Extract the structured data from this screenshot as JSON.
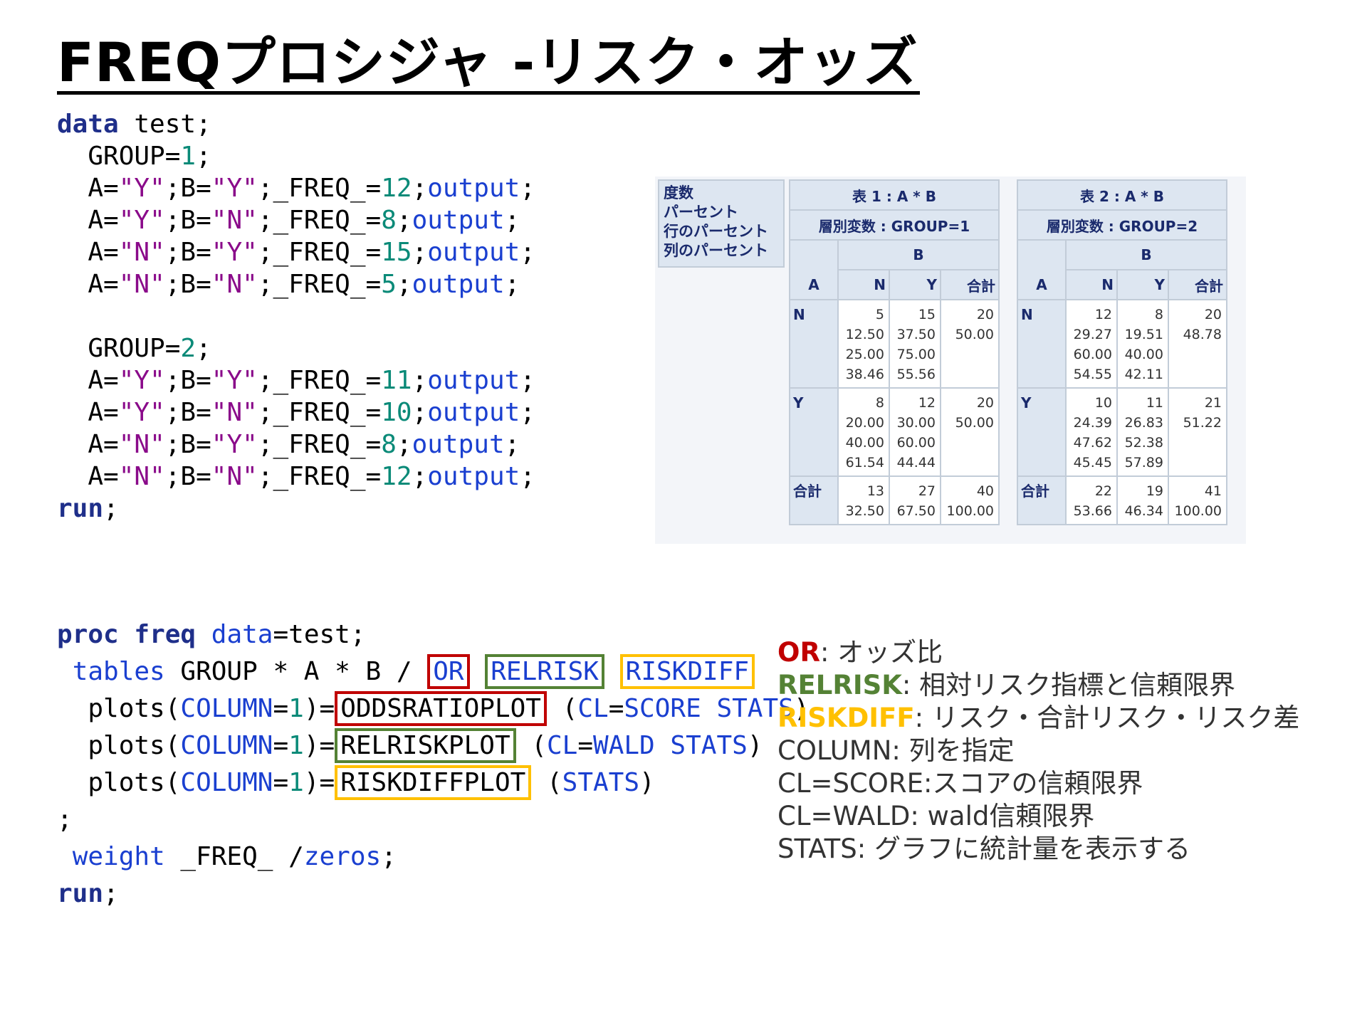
{
  "title": "FREQプロシジャ -リスク・オッズ",
  "data_step": {
    "kw_data": "data",
    "ds_name": " test;",
    "group1": "GROUP=",
    "group1_val": "1",
    "semi": ";",
    "g1_lines": [
      {
        "a": "\"Y\"",
        "b": "\"Y\"",
        "freq": "12"
      },
      {
        "a": "\"Y\"",
        "b": "\"N\"",
        "freq": "8"
      },
      {
        "a": "\"N\"",
        "b": "\"Y\"",
        "freq": "15"
      },
      {
        "a": "\"N\"",
        "b": "\"N\"",
        "freq": "5"
      }
    ],
    "group2_val": "2",
    "g2_lines": [
      {
        "a": "\"Y\"",
        "b": "\"Y\"",
        "freq": "11"
      },
      {
        "a": "\"Y\"",
        "b": "\"N\"",
        "freq": "10"
      },
      {
        "a": "\"N\"",
        "b": "\"Y\"",
        "freq": "8"
      },
      {
        "a": "\"N\"",
        "b": "\"N\"",
        "freq": "12"
      }
    ],
    "a_eq": "A=",
    "b_eq": ";B=",
    "freq_eq": ";_FREQ_=",
    "output": "output",
    "kw_run": "run"
  },
  "proc_step": {
    "kw_proc": "proc",
    "kw_freq": "freq",
    "data_opt": "data",
    "data_val": "=test;",
    "tables_kw": "tables",
    "tables_expr": " GROUP * A * B / ",
    "or": "OR",
    "relrisk": "RELRISK",
    "riskdiff": "RISKDIFF",
    "plots": "plots",
    "column": "COLUMN",
    "one": "1",
    "oddsratioplot": "ODDSRATIOPLOT",
    "relriskplot": "RELRISKPLOT",
    "riskdiffplot": "RISKDIFFPLOT",
    "cl": "CL",
    "score": "SCORE",
    "wald": "WALD",
    "stats": "STATS",
    "weight_kw": "weight",
    "weight_var": " _FREQ_ /",
    "zeros": "zeros",
    "kw_run": "run"
  },
  "freq_legend": [
    "度数",
    "パーセント",
    "行のパーセント",
    "列のパーセント"
  ],
  "freq_tables": [
    {
      "title": "表 1 : A * B",
      "strata": "層別変数 :  GROUP=1",
      "col_var": "B",
      "row_var": "A",
      "col_labels": [
        "N",
        "Y",
        "合計"
      ],
      "rows": [
        {
          "label": "N",
          "cells": [
            "5\n12.50\n25.00\n38.46",
            "15\n37.50\n75.00\n55.56",
            "20\n50.00"
          ]
        },
        {
          "label": "Y",
          "cells": [
            "8\n20.00\n40.00\n61.54",
            "12\n30.00\n60.00\n44.44",
            "20\n50.00"
          ]
        },
        {
          "label": "合計",
          "cells": [
            "13\n32.50",
            "27\n67.50",
            "40\n100.00"
          ]
        }
      ]
    },
    {
      "title": "表 2 : A * B",
      "strata": "層別変数 :  GROUP=2",
      "col_var": "B",
      "row_var": "A",
      "col_labels": [
        "N",
        "Y",
        "合計"
      ],
      "rows": [
        {
          "label": "N",
          "cells": [
            "12\n29.27\n60.00\n54.55",
            "8\n19.51\n40.00\n42.11",
            "20\n48.78"
          ]
        },
        {
          "label": "Y",
          "cells": [
            "10\n24.39\n47.62\n45.45",
            "11\n26.83\n52.38\n57.89",
            "21\n51.22"
          ]
        },
        {
          "label": "合計",
          "cells": [
            "22\n53.66",
            "19\n46.34",
            "41\n100.00"
          ]
        }
      ]
    }
  ],
  "notes": [
    {
      "key": "OR",
      "text": ": オッズ比",
      "color": "#c00000"
    },
    {
      "key": "RELRISK",
      "text": ": 相対リスク指標と信頼限界",
      "color": "#548235"
    },
    {
      "key": "RISKDIFF",
      "text": ": リスク・合計リスク・リスク差",
      "color": "#ffc000"
    },
    {
      "key": "",
      "text": "COLUMN: 列を指定",
      "color": "#333333"
    },
    {
      "key": "",
      "text": "CL=SCORE:スコアの信頼限界",
      "color": "#333333"
    },
    {
      "key": "",
      "text": "CL=WALD: wald信頼限界",
      "color": "#333333"
    },
    {
      "key": "",
      "text": "STATS: グラフに統計量を表示する",
      "color": "#333333"
    }
  ],
  "colors": {
    "keyword": "#1f2f8a",
    "number": "#0a8a78",
    "string": "#8a0a8a",
    "option": "#1a3fd0",
    "box_red": "#c00000",
    "box_green": "#548235",
    "box_yellow": "#ffc000"
  }
}
